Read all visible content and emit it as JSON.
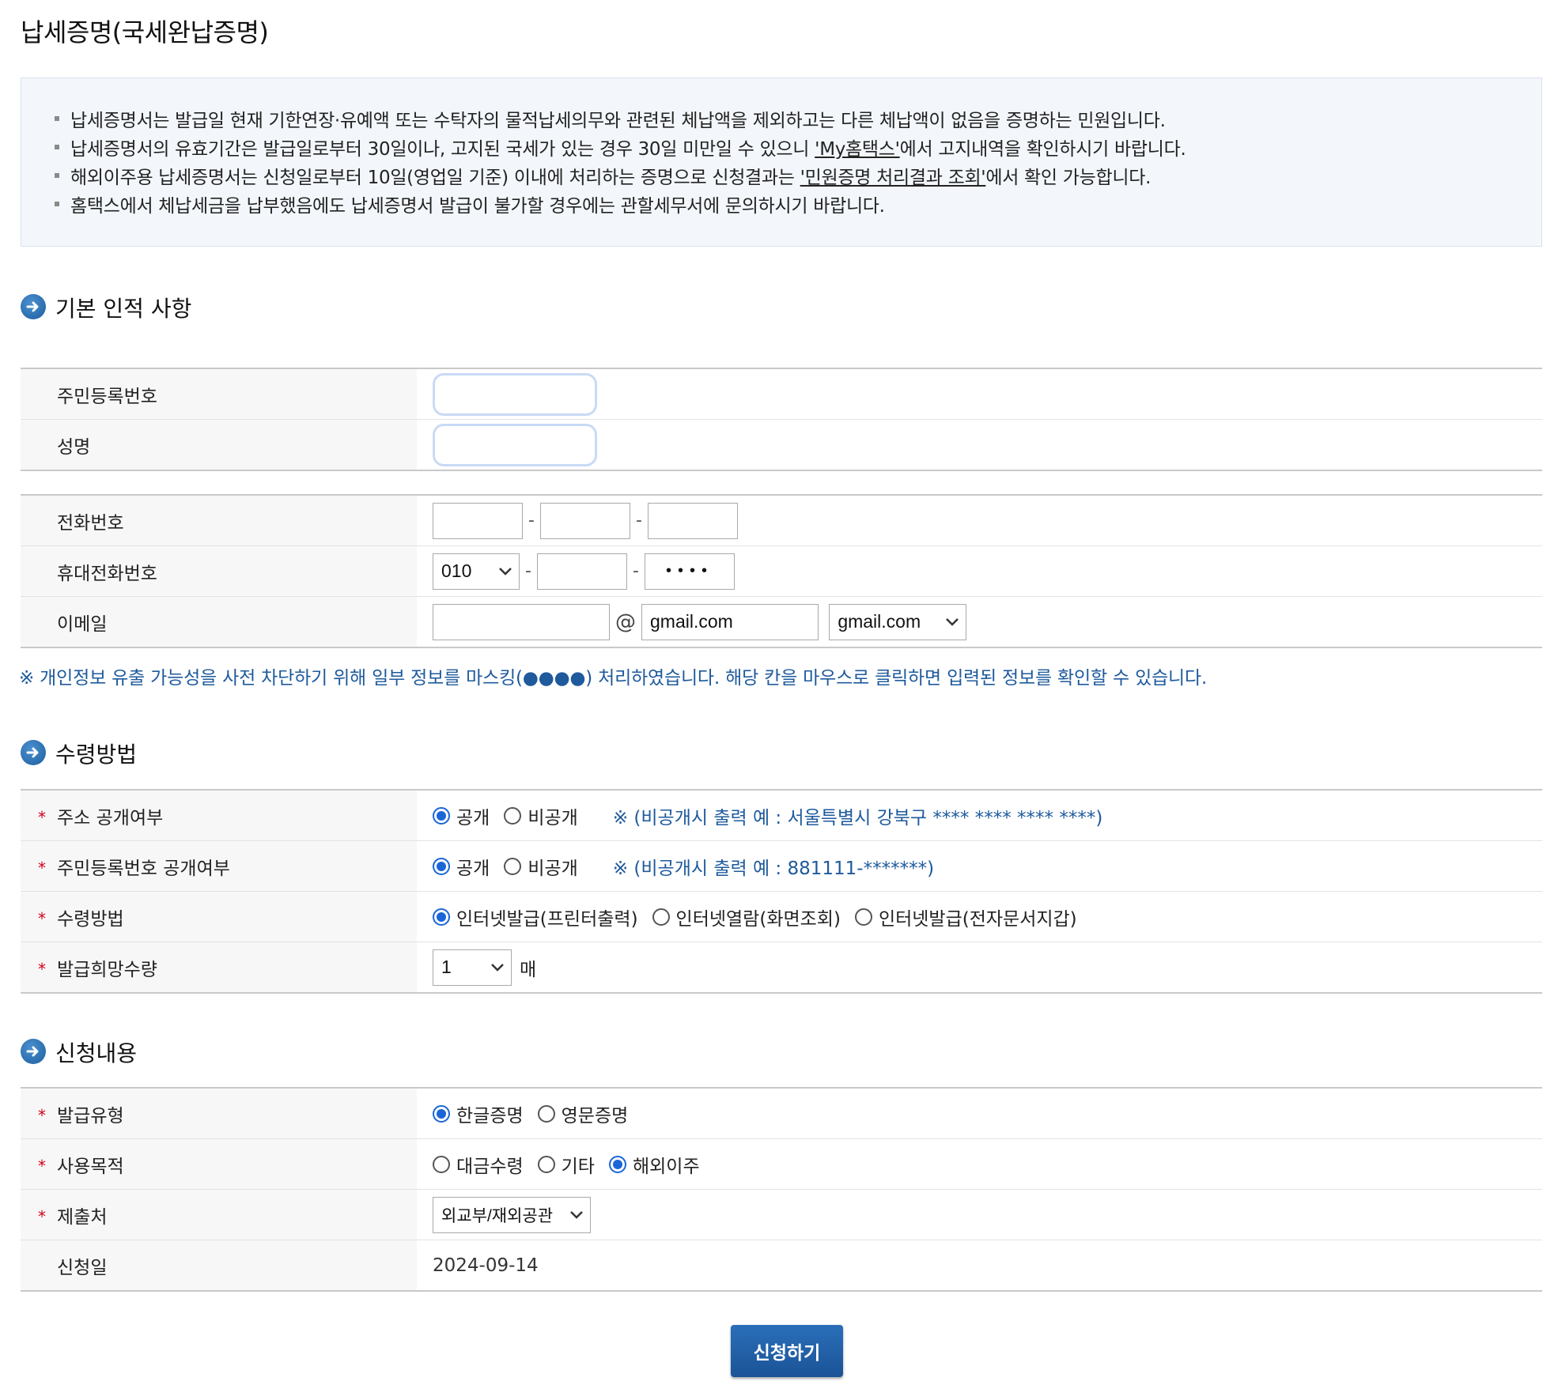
{
  "page": {
    "title": "납세증명(국세완납증명)"
  },
  "notice": {
    "item1": "납세증명서는 발급일 현재 기한연장·유예액 또는 수탁자의 물적납세의무와 관련된 체납액을 제외하고는 다른 체납액이 없음을 증명하는 민원입니다.",
    "item2_pre": "납세증명서의 유효기간은 발급일로부터 30일이나, 고지된 국세가 있는 경우 30일 미만일 수 있으니 ",
    "item2_link": "'My홈택스'",
    "item2_post": "에서 고지내역을 확인하시기 바랍니다.",
    "item3_pre": "해외이주용 납세증명서는 신청일로부터 10일(영업일 기준) 이내에 처리하는 증명으로 신청결과는 ",
    "item3_link": "'민원증명 처리결과 조회'",
    "item3_post": "에서 확인 가능합니다.",
    "item4": "홈택스에서 체납세금을 납부했음에도 납세증명서 발급이 불가할 경우에는 관할세무서에 문의하시기 바랍니다."
  },
  "basic": {
    "section_title": "기본 인적 사항",
    "rrn_label": "주민등록번호",
    "name_label": "성명",
    "phone_label": "전화번호",
    "mobile_label": "휴대전화번호",
    "mobile_prefix": "010",
    "mobile_last": "••••",
    "email_label": "이메일",
    "email_at": "@",
    "email_domain": "gmail.com",
    "email_select": "gmail.com",
    "mask_note": "※ 개인정보 유출 가능성을 사전 차단하기 위해 일부 정보를 마스킹(●●●●) 처리하였습니다. 해당 칸을 마우스로 클릭하면 입력된 정보를 확인할 수 있습니다."
  },
  "receive": {
    "section_title": "수령방법",
    "addr_label": "주소 공개여부",
    "rrn_label": "주민등록번호 공개여부",
    "open": "공개",
    "closed": "비공개",
    "addr_hint": "※ (비공개시 출력 예 : 서울특별시 강북구 **** **** **** ****)",
    "rrn_hint": "※ (비공개시 출력 예 : 881111-*******)",
    "method_label": "수령방법",
    "method_opt1": "인터넷발급(프린터출력)",
    "method_opt2": "인터넷열람(화면조회)",
    "method_opt3": "인터넷발급(전자문서지갑)",
    "qty_label": "발급희망수량",
    "qty_value": "1",
    "qty_unit": "매",
    "required_mark": "*"
  },
  "apply": {
    "section_title": "신청내용",
    "type_label": "발급유형",
    "type_opt1": "한글증명",
    "type_opt2": "영문증명",
    "purpose_label": "사용목적",
    "purpose_opt1": "대금수령",
    "purpose_opt2": "기타",
    "purpose_opt3": "해외이주",
    "submit_to_label": "제출처",
    "submit_to_value": "외교부/재외공관",
    "date_label": "신청일",
    "date_value": "2024-09-14"
  },
  "actions": {
    "submit_label": "신청하기"
  },
  "colors": {
    "accent": "#1b5396",
    "radio": "#1a66d8",
    "required": "#d0021b",
    "notice_bg": "#f3f7fb",
    "hint": "#1e5a9c"
  }
}
